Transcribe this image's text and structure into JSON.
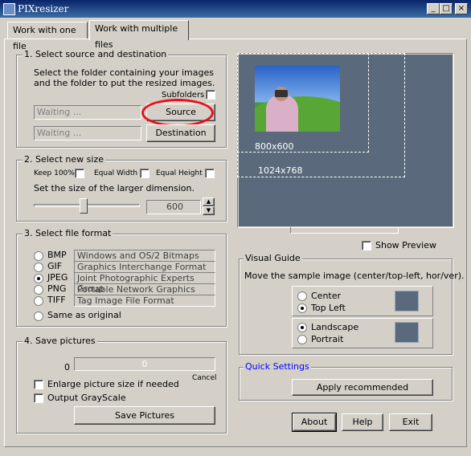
{
  "window": {
    "title": "PIXresizer",
    "min": "_",
    "max": "□",
    "close": "×"
  },
  "tabs": [
    "Work with one file",
    "Work with multiple files"
  ],
  "source": {
    "title": "1. Select source and destination",
    "description": "Select the folder containing your images and the folder to put the resized images.",
    "subfolders_label": "Subfolders",
    "source_value": "Waiting ...",
    "destination_value": "Waiting ...",
    "source_button": "Source",
    "destination_button": "Destination"
  },
  "size": {
    "title": "2. Select new size",
    "keep_label": "Keep 100%",
    "equal_width_label": "Equal Width",
    "equal_height_label": "Equal Height",
    "instruction": "Set the size of the larger dimension.",
    "value": "600",
    "slider_fraction": 0.47
  },
  "format": {
    "title": "3. Select file format",
    "options": [
      {
        "name": "BMP",
        "desc": "Windows and OS/2 Bitmaps",
        "selected": false
      },
      {
        "name": "GIF",
        "desc": "Graphics Interchange Format",
        "selected": false
      },
      {
        "name": "JPEG",
        "desc": "Joint Photographic Experts Group",
        "selected": true
      },
      {
        "name": "PNG",
        "desc": "Portable Network Graphics",
        "selected": false
      },
      {
        "name": "TIFF",
        "desc": "Tag Image File Format",
        "selected": false
      }
    ],
    "same_as_original": "Same as original"
  },
  "save": {
    "title": "4. Save pictures",
    "count": "0",
    "progress_value": "0",
    "cancel_label": "Cancel",
    "enlarge_label": "Enlarge picture size if needed",
    "grayscale_label": "Output GrayScale",
    "save_button": "Save Pictures"
  },
  "preview": {
    "label_800": "800x600",
    "label_1024": "1024x768",
    "show_preview_label": "Show Preview"
  },
  "visual_guide": {
    "title": "Visual Guide",
    "instruction": "Move the sample image (center/top-left, hor/ver).",
    "center_label": "Center",
    "top_left_label": "Top Left",
    "landscape_label": "Landscape",
    "portrait_label": "Portrait"
  },
  "quick_settings": {
    "title": "Quick Settings",
    "apply_button": "Apply recommended"
  },
  "footer": {
    "about": "About",
    "help": "Help",
    "exit": "Exit"
  },
  "colors": {
    "title_bar": "#0a246a",
    "preview_bg": "#5a6a7c",
    "highlight_circle": "#e8101c",
    "quick_settings_title": "#0000ff"
  }
}
